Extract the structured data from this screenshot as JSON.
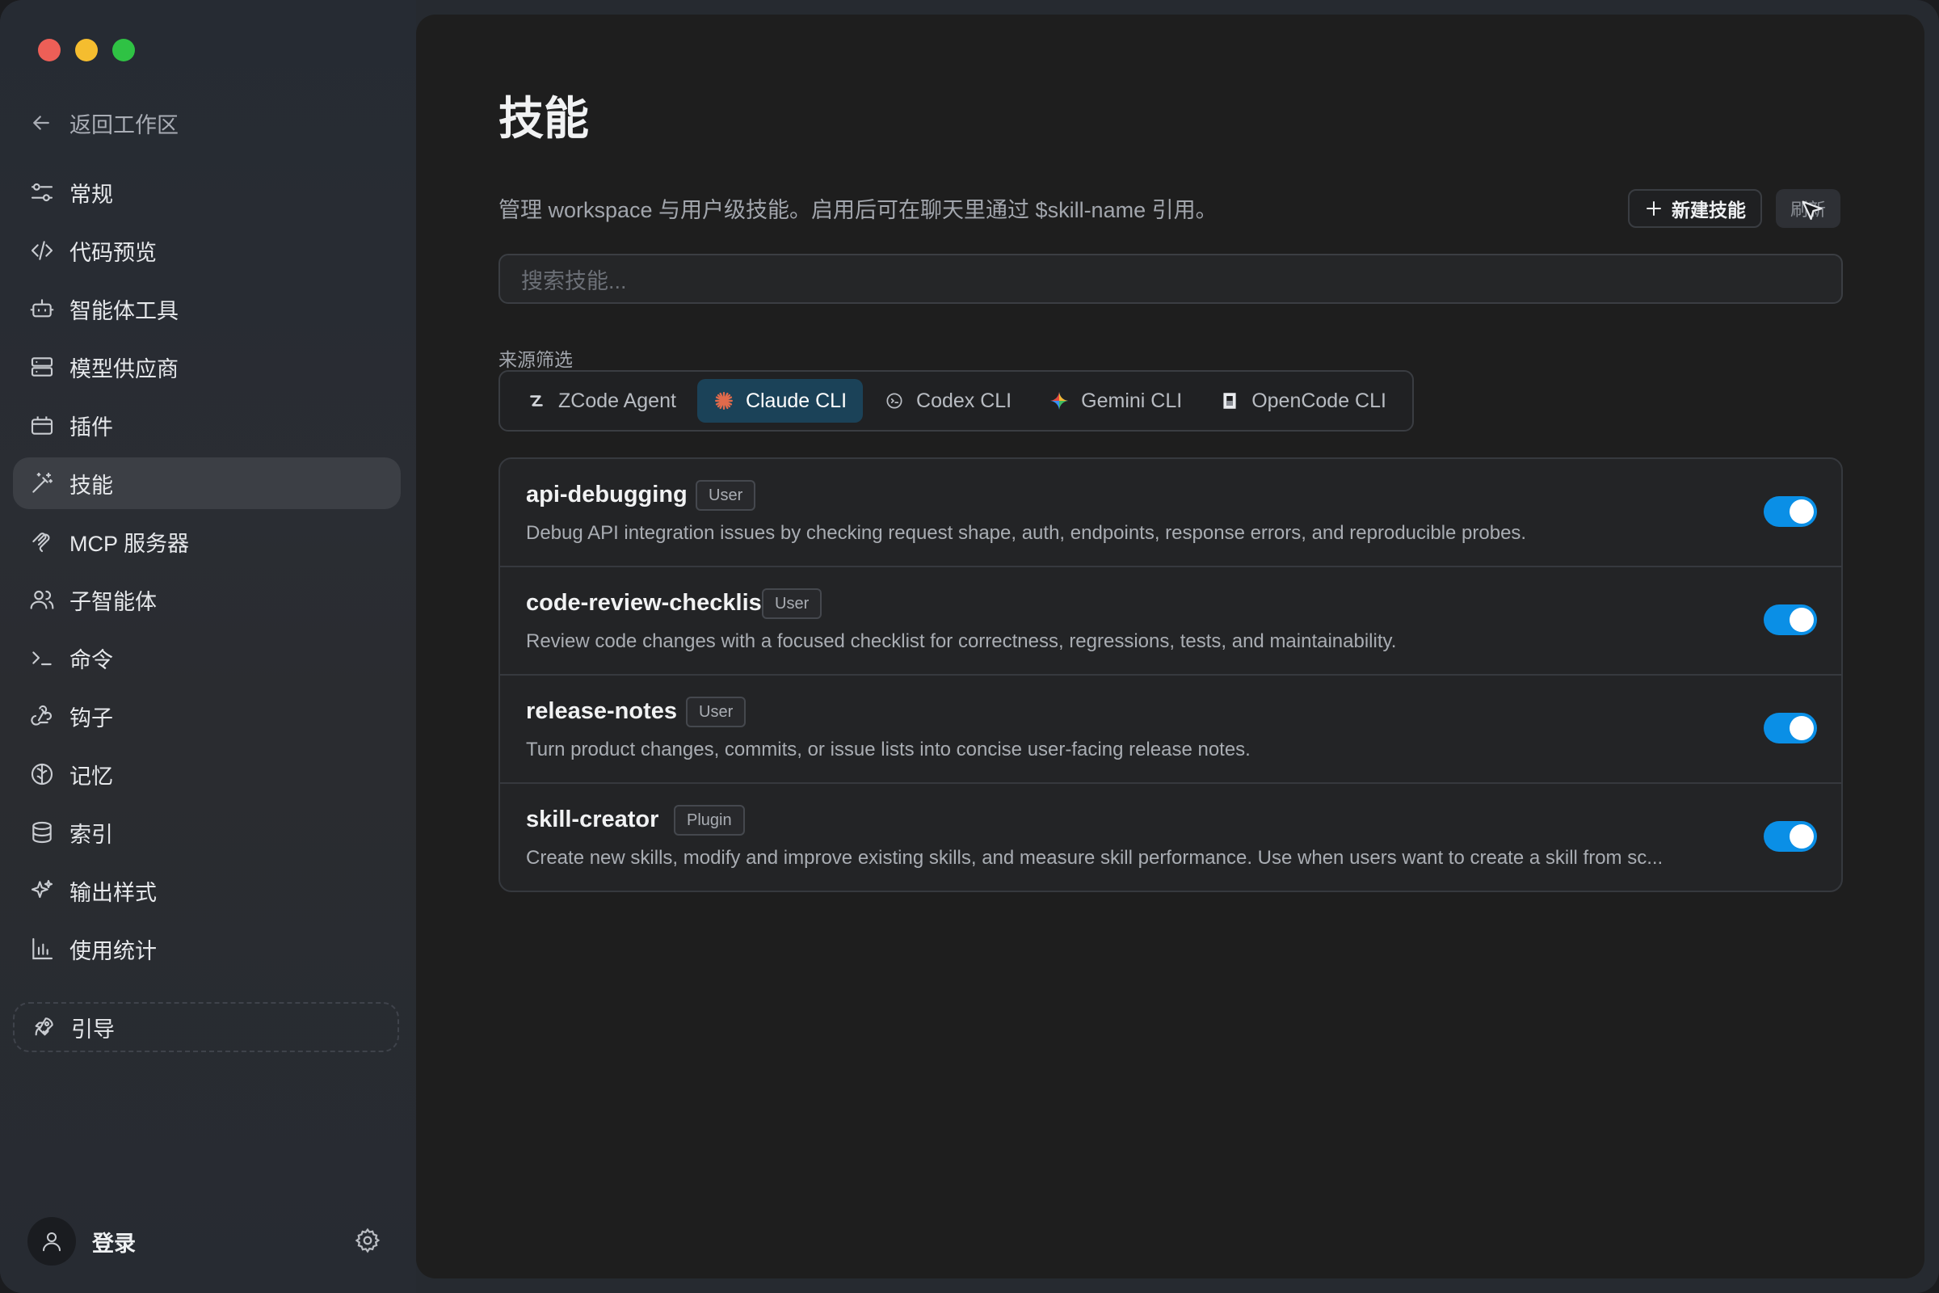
{
  "colors": {
    "accent": "#0a8fe6",
    "active_filter_bg": "#1b4258"
  },
  "sidebar": {
    "back_label": "返回工作区",
    "items": [
      {
        "label": "常规",
        "icon": "sliders-icon"
      },
      {
        "label": "代码预览",
        "icon": "code-icon"
      },
      {
        "label": "智能体工具",
        "icon": "robot-icon"
      },
      {
        "label": "模型供应商",
        "icon": "server-icon"
      },
      {
        "label": "插件",
        "icon": "plugin-icon"
      },
      {
        "label": "技能",
        "icon": "wand-icon",
        "active": true
      },
      {
        "label": "MCP 服务器",
        "icon": "mcp-icon"
      },
      {
        "label": "子智能体",
        "icon": "users-icon"
      },
      {
        "label": "命令",
        "icon": "terminal-icon"
      },
      {
        "label": "钩子",
        "icon": "webhook-icon"
      },
      {
        "label": "记忆",
        "icon": "brain-icon"
      },
      {
        "label": "索引",
        "icon": "database-icon"
      },
      {
        "label": "输出样式",
        "icon": "sparkles-icon"
      },
      {
        "label": "使用统计",
        "icon": "bar-chart-icon"
      }
    ],
    "guide_label": "引导",
    "login_label": "登录"
  },
  "main": {
    "title": "技能",
    "subtitle": "管理 workspace 与用户级技能。启用后可在聊天里通过 $skill-name 引用。",
    "new_button": "新建技能",
    "refresh_button": "刷新",
    "search_placeholder": "搜索技能...",
    "filter_label": "来源筛选",
    "filters": [
      {
        "label": "ZCode Agent",
        "icon": "zcode-icon",
        "active": false
      },
      {
        "label": "Claude CLI",
        "icon": "claude-icon",
        "active": true
      },
      {
        "label": "Codex CLI",
        "icon": "codex-icon",
        "active": false
      },
      {
        "label": "Gemini CLI",
        "icon": "gemini-icon",
        "active": false
      },
      {
        "label": "OpenCode CLI",
        "icon": "opencode-icon",
        "active": false
      }
    ],
    "skills": [
      {
        "name": "api-debugging",
        "badge": "User",
        "description": "Debug API integration issues by checking request shape, auth, endpoints, response errors, and reproducible probes.",
        "enabled": true
      },
      {
        "name": "code-review-checklist",
        "badge": "User",
        "description": "Review code changes with a focused checklist for correctness, regressions, tests, and maintainability.",
        "enabled": true
      },
      {
        "name": "release-notes",
        "badge": "User",
        "description": "Turn product changes, commits, or issue lists into concise user-facing release notes.",
        "enabled": true
      },
      {
        "name": "skill-creator",
        "badge": "Plugin",
        "description": "Create new skills, modify and improve existing skills, and measure skill performance. Use when users want to create a skill from sc...",
        "enabled": true
      }
    ]
  }
}
